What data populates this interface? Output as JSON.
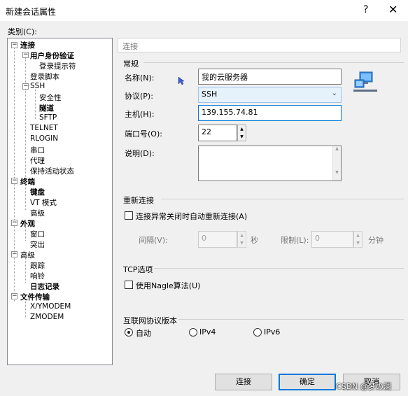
{
  "window": {
    "title": "新建会话属性",
    "help": "?",
    "close": "✕"
  },
  "category_label": "类别(C):",
  "tree": [
    {
      "label": "连接",
      "bold": true
    },
    {
      "label": "用户身份验证",
      "bold": true
    },
    {
      "label": "登录提示符",
      "bold": false
    },
    {
      "label": "登录脚本",
      "bold": false
    },
    {
      "label": "SSH",
      "bold": false
    },
    {
      "label": "安全性",
      "bold": false
    },
    {
      "label": "隧道",
      "bold": true
    },
    {
      "label": "SFTP",
      "bold": false
    },
    {
      "label": "TELNET",
      "bold": false
    },
    {
      "label": "RLOGIN",
      "bold": false
    },
    {
      "label": "串口",
      "bold": false
    },
    {
      "label": "代理",
      "bold": false
    },
    {
      "label": "保持活动状态",
      "bold": false
    },
    {
      "label": "终端",
      "bold": true
    },
    {
      "label": "键盘",
      "bold": true
    },
    {
      "label": "VT 模式",
      "bold": false
    },
    {
      "label": "高级",
      "bold": false
    },
    {
      "label": "外观",
      "bold": true
    },
    {
      "label": "窗口",
      "bold": false
    },
    {
      "label": "突出",
      "bold": false
    },
    {
      "label": "高级",
      "bold": false
    },
    {
      "label": "跟踪",
      "bold": false
    },
    {
      "label": "响铃",
      "bold": false
    },
    {
      "label": "日志记录",
      "bold": true
    },
    {
      "label": "文件传输",
      "bold": true
    },
    {
      "label": "X/YMODEM",
      "bold": false
    },
    {
      "label": "ZMODEM",
      "bold": false
    }
  ],
  "panel_title": "连接",
  "general": {
    "header": "常规",
    "name_label": "名称(N):",
    "name_value": "我的云服务器",
    "protocol_label": "协议(P):",
    "protocol_value": "SSH",
    "host_label": "主机(H):",
    "host_value": "139.155.74.81",
    "port_label": "端口号(O):",
    "port_value": "22",
    "desc_label": "说明(D):",
    "desc_value": ""
  },
  "reconnect": {
    "header": "重新连接",
    "checkbox_label": "连接异常关闭时自动重新连接(A)",
    "checked": false,
    "interval_label": "间隔(V):",
    "interval_value": "0",
    "interval_unit": "秒",
    "limit_label": "限制(L):",
    "limit_value": "0",
    "limit_unit": "分钟"
  },
  "tcp": {
    "header": "TCP选项",
    "nagle_label": "使用Nagle算法(U)",
    "checked": false
  },
  "ip": {
    "header": "互联网协议版本",
    "options": [
      "自动",
      "IPv4",
      "IPv6"
    ],
    "selected": "自动"
  },
  "buttons": {
    "connect": "连接",
    "ok": "确定",
    "cancel": "取消"
  },
  "watermark": "CSDN @梦の澜",
  "colors": {
    "accent": "#0078d7",
    "window_bg": "#f0f0f0"
  }
}
